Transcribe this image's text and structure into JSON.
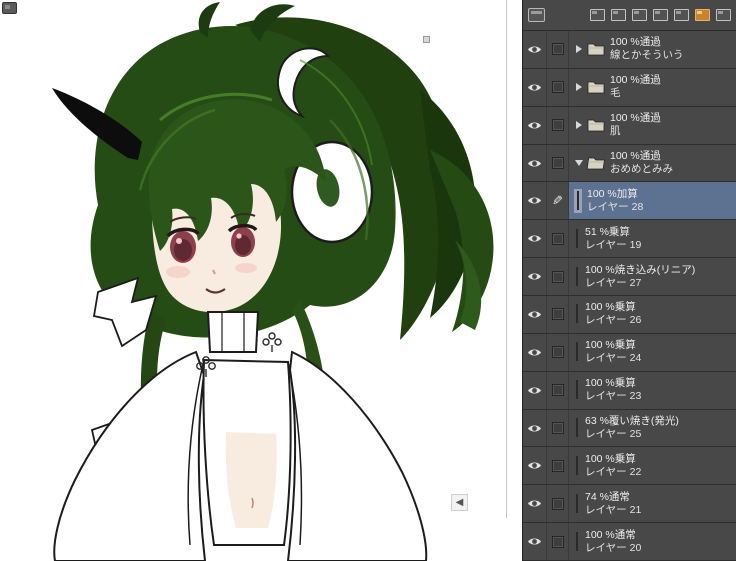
{
  "canvas": {
    "scroll_arrow_glyph": "◀",
    "bg_color": "#ffffff"
  },
  "panel": {
    "bg_color": "#484848",
    "selected_row_color": "#5d7191",
    "active_icon_color": "#c9822e",
    "header_icons": [
      {
        "name": "float-panel-icon",
        "active": false
      },
      {
        "name": "float-all-panels-icon",
        "active": false
      },
      {
        "name": "dock-panel-icon",
        "active": false
      },
      {
        "name": "add-panel-icon",
        "active": false
      },
      {
        "name": "merge-panel-icon",
        "active": false
      },
      {
        "name": "active-panel-icon",
        "active": true
      },
      {
        "name": "panel-menu-icon",
        "active": false
      }
    ],
    "rows": [
      {
        "kind": "folder",
        "visible": true,
        "expanded": false,
        "blend": "100 %通過",
        "label": "線とかそういう"
      },
      {
        "kind": "folder",
        "visible": true,
        "expanded": false,
        "blend": "100 %通過",
        "label": "毛"
      },
      {
        "kind": "folder",
        "visible": true,
        "expanded": false,
        "blend": "100 %通過",
        "label": "肌"
      },
      {
        "kind": "folder",
        "visible": true,
        "expanded": true,
        "blend": "100 %通過",
        "label": "おめめとみみ"
      },
      {
        "kind": "layer",
        "visible": true,
        "selected": true,
        "editing": true,
        "blend": "100 %加算",
        "label": "レイヤー 28"
      },
      {
        "kind": "layer",
        "visible": true,
        "blend": "51 %乗算",
        "label": "レイヤー 19"
      },
      {
        "kind": "layer",
        "visible": true,
        "blend": "100 %焼き込み(リニア)",
        "label": "レイヤー 27"
      },
      {
        "kind": "layer",
        "visible": true,
        "blend": "100 %乗算",
        "label": "レイヤー 26"
      },
      {
        "kind": "layer",
        "visible": true,
        "blend": "100 %乗算",
        "label": "レイヤー 24"
      },
      {
        "kind": "layer",
        "visible": true,
        "blend": "100 %乗算",
        "label": "レイヤー 23"
      },
      {
        "kind": "layer",
        "visible": true,
        "blend": "63 %覆い焼き(発光)",
        "label": "レイヤー 25"
      },
      {
        "kind": "layer",
        "visible": true,
        "blend": "100 %乗算",
        "label": "レイヤー 22"
      },
      {
        "kind": "layer",
        "visible": true,
        "blend": "74 %通常",
        "label": "レイヤー 21"
      },
      {
        "kind": "layer",
        "visible": true,
        "blend": "100 %通常",
        "label": "レイヤー 20"
      }
    ]
  }
}
